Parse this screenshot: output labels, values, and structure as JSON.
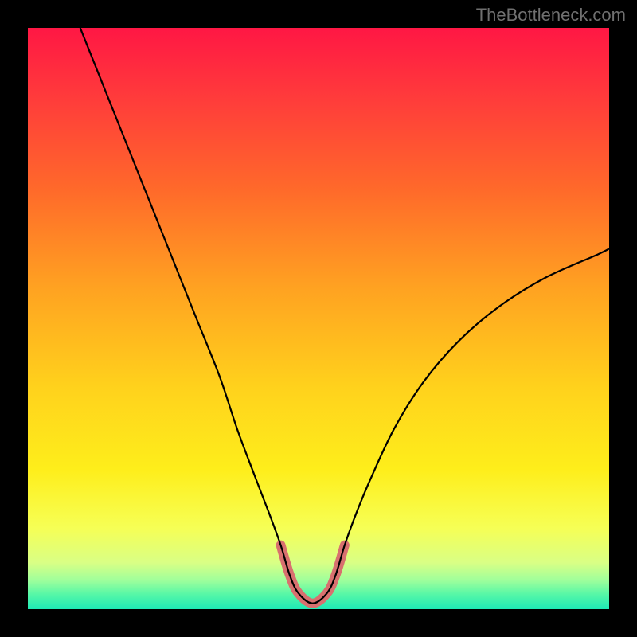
{
  "watermark": "TheBottleneck.com",
  "chart_data": {
    "type": "line",
    "title": "",
    "xlabel": "",
    "ylabel": "",
    "xlim": [
      0,
      100
    ],
    "ylim": [
      0,
      100
    ],
    "gradient_stops": [
      {
        "pos": 0.0,
        "color": "#ff1744"
      },
      {
        "pos": 0.12,
        "color": "#ff3b3b"
      },
      {
        "pos": 0.28,
        "color": "#ff6a2a"
      },
      {
        "pos": 0.45,
        "color": "#ffa321"
      },
      {
        "pos": 0.62,
        "color": "#ffd21c"
      },
      {
        "pos": 0.76,
        "color": "#feee1b"
      },
      {
        "pos": 0.86,
        "color": "#f6ff55"
      },
      {
        "pos": 0.92,
        "color": "#d9ff85"
      },
      {
        "pos": 0.95,
        "color": "#a0ff9b"
      },
      {
        "pos": 0.975,
        "color": "#55f7a7"
      },
      {
        "pos": 1.0,
        "color": "#1de9b6"
      }
    ],
    "series": [
      {
        "name": "main-curve",
        "color": "#000000",
        "width": 2.2,
        "x": [
          9.0,
          13,
          17,
          21,
          25,
          29,
          33,
          36,
          39,
          41.5,
          43.5,
          45.0,
          46.5,
          49.0,
          51.5,
          53.0,
          54.5,
          56.5,
          59,
          63,
          68,
          74,
          81,
          89,
          98,
          100
        ],
        "y": [
          100,
          90,
          80,
          70,
          60,
          50,
          40,
          31,
          23,
          16.5,
          11.0,
          6.0,
          2.8,
          1.0,
          2.8,
          6.0,
          11.0,
          16.5,
          22.5,
          31,
          39,
          46,
          52,
          57,
          61,
          62
        ]
      },
      {
        "name": "highlight-curve",
        "color": "#d8706f",
        "width": 12,
        "cap": "round",
        "x": [
          43.5,
          45.0,
          46.5,
          49.0,
          51.5,
          53.0,
          54.5
        ],
        "y": [
          11.0,
          6.0,
          2.8,
          1.0,
          2.8,
          6.0,
          11.0
        ]
      }
    ],
    "annotations": []
  }
}
